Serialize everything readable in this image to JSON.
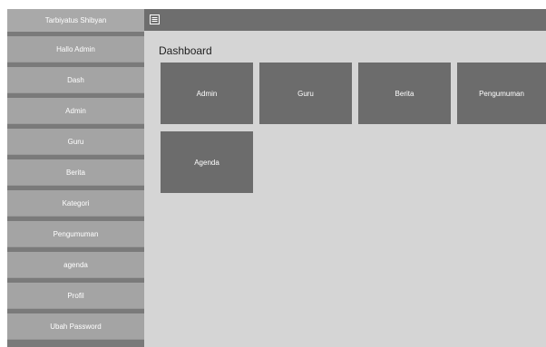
{
  "sidebar": {
    "brand": "Tarbiyatus Shibyan",
    "greeting": "Hallo Admin",
    "items": [
      {
        "label": "Dash"
      },
      {
        "label": "Admin"
      },
      {
        "label": "Guru"
      },
      {
        "label": "Berita"
      },
      {
        "label": "Kategori"
      },
      {
        "label": "Pengumuman"
      },
      {
        "label": "agenda"
      },
      {
        "label": "Profil"
      },
      {
        "label": "Ubah Password"
      }
    ]
  },
  "topbar": {
    "menu_icon": "list-icon"
  },
  "main": {
    "title": "Dashboard",
    "tiles": [
      {
        "label": "Admin"
      },
      {
        "label": "Guru"
      },
      {
        "label": "Berita"
      },
      {
        "label": "Pengumuman"
      },
      {
        "label": "Agenda"
      }
    ]
  },
  "colors": {
    "sidebar_item": "#a4a4a4",
    "sidebar_gap": "#7a7a7a",
    "topbar": "#6e6e6e",
    "tile": "#6c6c6c",
    "content_bg": "#d5d5d5"
  }
}
